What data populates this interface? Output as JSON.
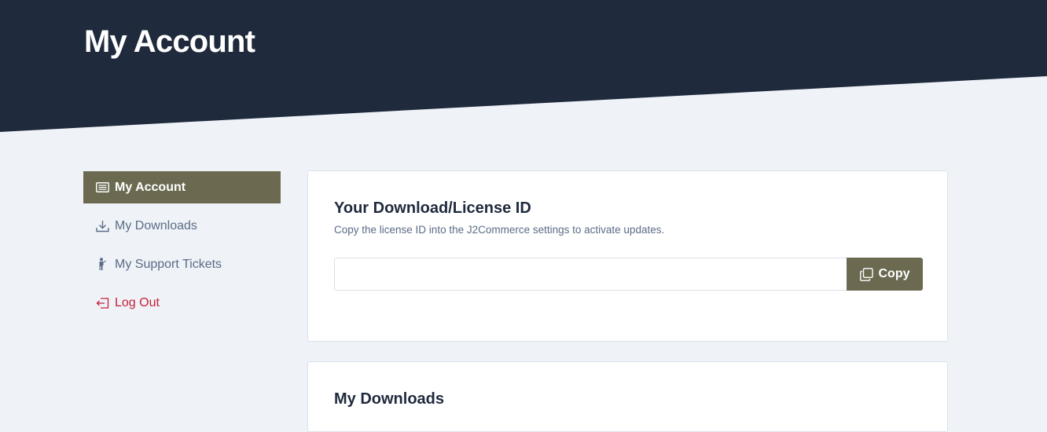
{
  "header": {
    "title": "My Account",
    "background_color": "#1f2a3d"
  },
  "sidebar": {
    "items": [
      {
        "label": "My Account",
        "icon": "list-icon",
        "active": true
      },
      {
        "label": "My Downloads",
        "icon": "download-icon",
        "active": false
      },
      {
        "label": "My Support Tickets",
        "icon": "person-icon",
        "active": false
      },
      {
        "label": "Log Out",
        "icon": "logout-icon",
        "active": false
      }
    ]
  },
  "license_card": {
    "title": "Your Download/License ID",
    "description": "Copy the license ID into the J2Commerce settings to activate updates.",
    "input_value": "",
    "input_placeholder": "",
    "copy_label": "Copy",
    "copy_icon": "copy-icon"
  },
  "downloads_card": {
    "title": "My Downloads"
  },
  "colors": {
    "accent": "#6b6a51",
    "page_background": "#eff3f8",
    "logout": "#c8203a",
    "muted_text": "#5b6b85"
  }
}
